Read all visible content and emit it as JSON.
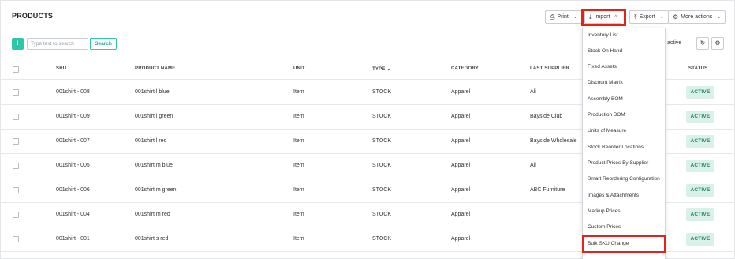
{
  "page": {
    "title": "PRODUCTS"
  },
  "header": {
    "print_label": "Print",
    "import_label": "Import",
    "export_label": "Export",
    "more_actions_label": "More actions"
  },
  "toolbar": {
    "add_label": "+",
    "search_placeholder": "Type text to search",
    "search_button": "Search",
    "only_active_label": "ly active"
  },
  "table": {
    "columns": [
      "SKU",
      "PRODUCT NAME",
      "UNIT",
      "TYPE",
      "CATEGORY",
      "LAST SUPPLIER",
      "STATUS"
    ],
    "rows": [
      {
        "sku": "001shirt - 008",
        "name": "001shirt l blue",
        "unit": "Item",
        "type": "STOCK",
        "category": "Apparel",
        "supplier": "Ali",
        "status": "ACTIVE"
      },
      {
        "sku": "001shirt - 009",
        "name": "001shirt l green",
        "unit": "Item",
        "type": "STOCK",
        "category": "Apparel",
        "supplier": "Bayside Club",
        "status": "ACTIVE"
      },
      {
        "sku": "001shirt - 007",
        "name": "001shirt l red",
        "unit": "Item",
        "type": "STOCK",
        "category": "Apparel",
        "supplier": "Bayside Wholesale",
        "status": "ACTIVE"
      },
      {
        "sku": "001shirt - 005",
        "name": "001shirt m blue",
        "unit": "Item",
        "type": "STOCK",
        "category": "Apparel",
        "supplier": "Ali",
        "status": "ACTIVE"
      },
      {
        "sku": "001shirt - 006",
        "name": "001shirt m green",
        "unit": "Item",
        "type": "STOCK",
        "category": "Apparel",
        "supplier": "ABC Furniture",
        "status": "ACTIVE"
      },
      {
        "sku": "001shirt - 004",
        "name": "001shirt m red",
        "unit": "Item",
        "type": "STOCK",
        "category": "Apparel",
        "supplier": "",
        "status": "ACTIVE"
      },
      {
        "sku": "001shirt - 001",
        "name": "001shirt s red",
        "unit": "Item",
        "type": "STOCK",
        "category": "Apparel",
        "supplier": "",
        "status": "ACTIVE"
      }
    ]
  },
  "import_menu": {
    "items": [
      "Inventory List",
      "Stock On Hand",
      "Fixed Assets",
      "Discount Matrix",
      "Assembly BOM",
      "Production BOM",
      "Units of Measure",
      "Stock Reorder Locations",
      "Product Prices By Supplier",
      "Smart Reordering Configuration",
      "Images & Attachments",
      "Markup Prices",
      "Custom Prices",
      "Bulk SKU Change"
    ]
  },
  "colors": {
    "accent": "#2ec5a8",
    "highlight": "#e0241b",
    "status_bg": "#d9f1e8",
    "status_text": "#1f8a62"
  }
}
